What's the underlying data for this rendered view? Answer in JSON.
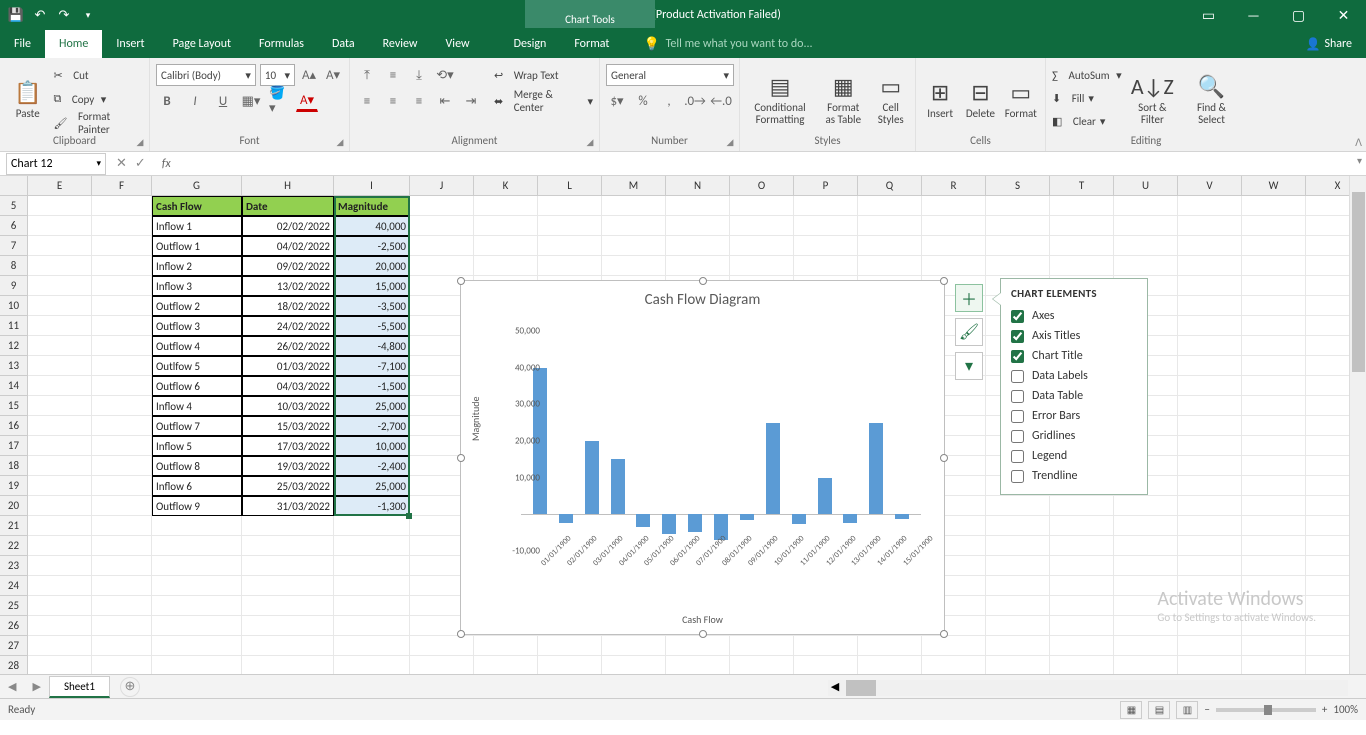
{
  "title": "Book1 - Excel (Product Activation Failed)",
  "charttools": "Chart Tools",
  "tabs": {
    "file": "File",
    "home": "Home",
    "insert": "Insert",
    "pagelayout": "Page Layout",
    "formulas": "Formulas",
    "data": "Data",
    "review": "Review",
    "view": "View",
    "design": "Design",
    "format": "Format"
  },
  "tellme": "Tell me what you want to do...",
  "share": "Share",
  "ribbon": {
    "clipboard": {
      "paste": "Paste",
      "cut": "Cut",
      "copy": "Copy",
      "formatpainter": "Format Painter",
      "label": "Clipboard"
    },
    "font": {
      "name": "Calibri (Body)",
      "size": "10",
      "label": "Font"
    },
    "alignment": {
      "wrap": "Wrap Text",
      "merge": "Merge & Center",
      "label": "Alignment"
    },
    "number": {
      "format": "General",
      "label": "Number"
    },
    "styles": {
      "cond": "Conditional Formatting",
      "fmttable": "Format as Table",
      "cellstyles": "Cell Styles",
      "label": "Styles"
    },
    "cells": {
      "insert": "Insert",
      "delete": "Delete",
      "format": "Format",
      "label": "Cells"
    },
    "editing": {
      "autosum": "AutoSum",
      "fill": "Fill",
      "clear": "Clear",
      "sort": "Sort & Filter",
      "find": "Find & Select",
      "label": "Editing"
    }
  },
  "namebox": "Chart 12",
  "columns": [
    "E",
    "F",
    "G",
    "H",
    "I",
    "J",
    "K",
    "L",
    "M",
    "N",
    "O",
    "P",
    "Q",
    "R",
    "S",
    "T",
    "U",
    "V",
    "W",
    "X"
  ],
  "rownums": [
    5,
    6,
    7,
    8,
    9,
    10,
    11,
    12,
    13,
    14,
    15,
    16,
    17,
    18,
    19,
    20,
    21,
    22,
    23,
    24,
    25,
    26,
    27,
    28
  ],
  "table": {
    "headers": {
      "cashflow": "Cash Flow",
      "date": "Date",
      "magnitude": "Magnitude"
    },
    "rows": [
      {
        "cf": "Inflow 1",
        "date": "02/02/2022",
        "mag": "40,000"
      },
      {
        "cf": "Outflow 1",
        "date": "04/02/2022",
        "mag": "-2,500"
      },
      {
        "cf": "Inflow 2",
        "date": "09/02/2022",
        "mag": "20,000"
      },
      {
        "cf": "Inflow 3",
        "date": "13/02/2022",
        "mag": "15,000"
      },
      {
        "cf": "Outflow 2",
        "date": "18/02/2022",
        "mag": "-3,500"
      },
      {
        "cf": "Outflow 3",
        "date": "24/02/2022",
        "mag": "-5,500"
      },
      {
        "cf": "Outflow 4",
        "date": "26/02/2022",
        "mag": "-4,800"
      },
      {
        "cf": "Outlfow 5",
        "date": "01/03/2022",
        "mag": "-7,100"
      },
      {
        "cf": "Outflow 6",
        "date": "04/03/2022",
        "mag": "-1,500"
      },
      {
        "cf": "Inflow 4",
        "date": "10/03/2022",
        "mag": "25,000"
      },
      {
        "cf": "Outflow 7",
        "date": "15/03/2022",
        "mag": "-2,700"
      },
      {
        "cf": "Inflow 5",
        "date": "17/03/2022",
        "mag": "10,000"
      },
      {
        "cf": "Outflow 8",
        "date": "19/03/2022",
        "mag": "-2,400"
      },
      {
        "cf": "Inflow 6",
        "date": "25/03/2022",
        "mag": "25,000"
      },
      {
        "cf": "Outflow 9",
        "date": "31/03/2022",
        "mag": "-1,300"
      }
    ]
  },
  "chart": {
    "title": "Cash Flow Diagram",
    "ylabel": "Magnitude",
    "xlabel": "Cash Flow"
  },
  "chart_data": {
    "type": "bar",
    "title": "Cash Flow Diagram",
    "xlabel": "Cash Flow",
    "ylabel": "Magnitude",
    "ylim": [
      -10000,
      50000
    ],
    "yticks": [
      "-10,000",
      "10,000",
      "20,000",
      "30,000",
      "40,000",
      "50,000"
    ],
    "ytick_vals": [
      -10000,
      10000,
      20000,
      30000,
      40000,
      50000
    ],
    "categories": [
      "01/01/1900",
      "02/01/1900",
      "03/01/1900",
      "04/01/1900",
      "05/01/1900",
      "06/01/1900",
      "07/01/1900",
      "08/01/1900",
      "09/01/1900",
      "10/01/1900",
      "11/01/1900",
      "12/01/1900",
      "13/01/1900",
      "14/01/1900",
      "15/01/1900"
    ],
    "values": [
      40000,
      -2500,
      20000,
      15000,
      -3500,
      -5500,
      -4800,
      -7100,
      -1500,
      25000,
      -2700,
      10000,
      -2400,
      25000,
      -1300
    ]
  },
  "chartelements": {
    "title": "CHART ELEMENTS",
    "items": [
      {
        "label": "Axes",
        "checked": true
      },
      {
        "label": "Axis Titles",
        "checked": true
      },
      {
        "label": "Chart Title",
        "checked": true
      },
      {
        "label": "Data Labels",
        "checked": false
      },
      {
        "label": "Data Table",
        "checked": false
      },
      {
        "label": "Error Bars",
        "checked": false
      },
      {
        "label": "Gridlines",
        "checked": false
      },
      {
        "label": "Legend",
        "checked": false
      },
      {
        "label": "Trendline",
        "checked": false
      }
    ]
  },
  "sheet": "Sheet1",
  "status": "Ready",
  "zoom": "100%",
  "watermark": {
    "t1": "Activate Windows",
    "t2": "Go to Settings to activate Windows."
  }
}
